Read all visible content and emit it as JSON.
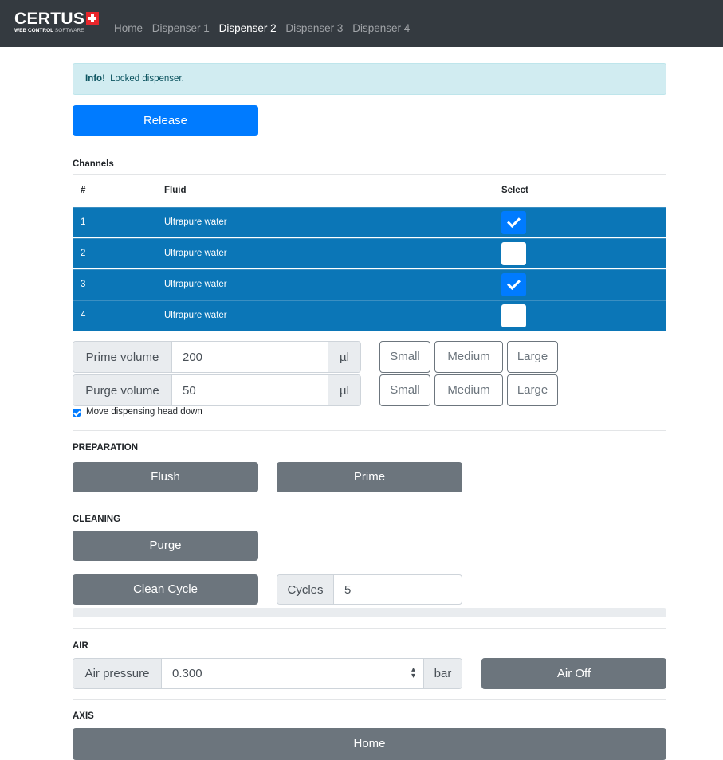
{
  "brand": {
    "name": "CERTUS",
    "sub_bold": "WEB CONTROL",
    "sub_soft": "SOFTWARE"
  },
  "nav": {
    "items": [
      "Home",
      "Dispenser 1",
      "Dispenser 2",
      "Dispenser 3",
      "Dispenser 4"
    ],
    "active_index": 2
  },
  "alert": {
    "strong": "Info!",
    "text": "Locked dispenser."
  },
  "release_button": "Release",
  "channels": {
    "label": "Channels",
    "columns": [
      "#",
      "Fluid",
      "Select"
    ],
    "rows": [
      {
        "num": "1",
        "fluid": "Ultrapure water",
        "selected": true
      },
      {
        "num": "2",
        "fluid": "Ultrapure water",
        "selected": false
      },
      {
        "num": "3",
        "fluid": "Ultrapure water",
        "selected": true
      },
      {
        "num": "4",
        "fluid": "Ultrapure water",
        "selected": false
      }
    ]
  },
  "prime": {
    "label": "Prime volume",
    "value": "200",
    "unit": "µl"
  },
  "purge": {
    "label": "Purge volume",
    "value": "50",
    "unit": "µl"
  },
  "size_buttons": [
    "Small",
    "Medium",
    "Large"
  ],
  "move_head": {
    "label": "Move dispensing head down",
    "checked": true
  },
  "preparation": {
    "label": "PREPARATION",
    "flush": "Flush",
    "prime": "Prime"
  },
  "cleaning": {
    "label": "CLEANING",
    "purge": "Purge",
    "clean_cycle": "Clean Cycle",
    "cycles_label": "Cycles",
    "cycles_value": "5",
    "progress": 0
  },
  "air": {
    "label": "AIR",
    "pressure_label": "Air pressure",
    "pressure_value": "0.300",
    "unit": "bar",
    "toggle": "Air Off"
  },
  "axis": {
    "label": "AXIS",
    "home": "Home"
  },
  "colors": {
    "navbar": "#343a40",
    "primary": "#007bff",
    "row": "#0b76b7",
    "secondary": "#6c757d",
    "info_bg": "#d1ecf1"
  }
}
